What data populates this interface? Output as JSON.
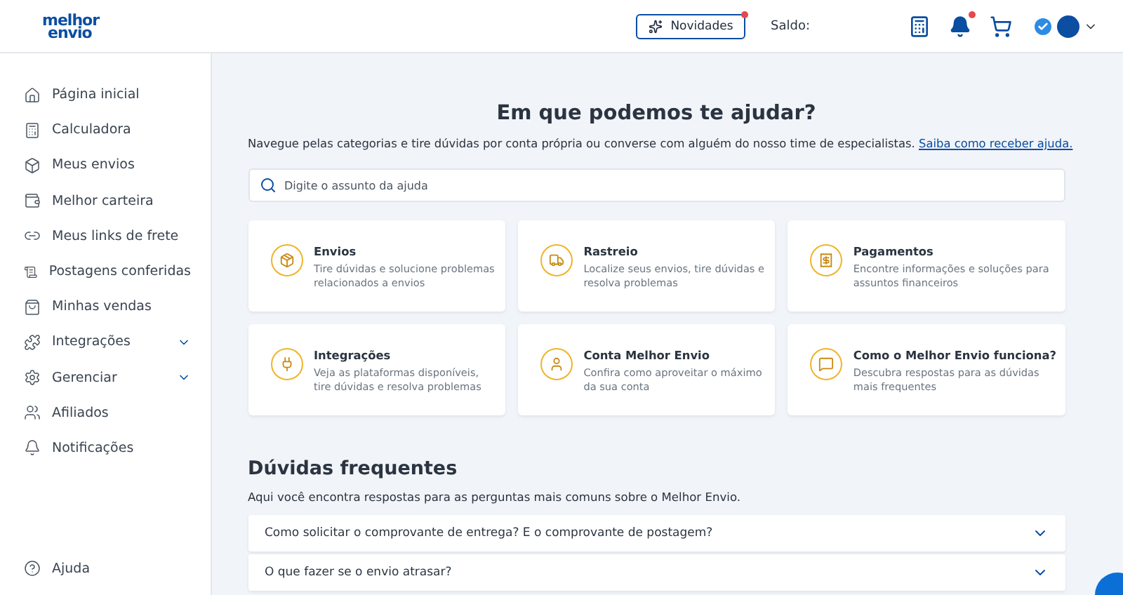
{
  "header": {
    "logo": [
      "melhor",
      "envio"
    ],
    "news_button": {
      "label": "Novidades",
      "has_alert": true
    },
    "balance_label": "Saldo:",
    "notifications_alert": true,
    "verified": true
  },
  "sidebar": {
    "items": [
      {
        "label": "Página inicial",
        "expandable": false
      },
      {
        "label": "Calculadora",
        "expandable": false
      },
      {
        "label": "Meus envios",
        "expandable": false
      },
      {
        "label": "Melhor carteira",
        "expandable": false
      },
      {
        "label": "Meus links de frete",
        "expandable": false
      },
      {
        "label": "Postagens conferidas",
        "expandable": false
      },
      {
        "label": "Minhas vendas",
        "expandable": false
      },
      {
        "label": "Integrações",
        "expandable": true
      },
      {
        "label": "Gerenciar",
        "expandable": true
      },
      {
        "label": "Afiliados",
        "expandable": false
      },
      {
        "label": "Notificações",
        "expandable": false
      }
    ],
    "footer_item": "Ajuda"
  },
  "help": {
    "title": "Em que podemos te ajudar?",
    "subtitle": "Navegue pelas categorias e tire dúvidas por conta própria ou converse com alguém do nosso time de especialistas.",
    "subtitle_link": "Saiba como receber ajuda.",
    "search": {
      "placeholder": "Digite o assunto da ajuda"
    }
  },
  "categories": [
    {
      "title": "Envios",
      "description": "Tire dúvidas e solucione problemas relacionados a envios"
    },
    {
      "title": "Rastreio",
      "description": "Localize seus envios, tire dúvidas e resolva problemas"
    },
    {
      "title": "Pagamentos",
      "description": "Encontre informações e soluções para assuntos financeiros"
    },
    {
      "title": "Integrações",
      "description": "Veja as plataformas disponíveis, tire dúvidas e resolva problemas"
    },
    {
      "title": "Conta Melhor Envio",
      "description": "Confira como aproveitar o máximo da sua conta"
    },
    {
      "title": "Como o Melhor Envio funciona?",
      "description": "Descubra respostas para as dúvidas mais frequentes"
    }
  ],
  "faq": {
    "title": "Dúvidas frequentes",
    "description": "Aqui você encontra respostas para as perguntas mais comuns sobre o Melhor Envio.",
    "items": [
      {
        "question": "Como solicitar o comprovante de entrega? E o comprovante de postagem?",
        "expanded": false
      },
      {
        "question": "O que fazer se o envio atrasar?",
        "expanded": false
      }
    ]
  }
}
